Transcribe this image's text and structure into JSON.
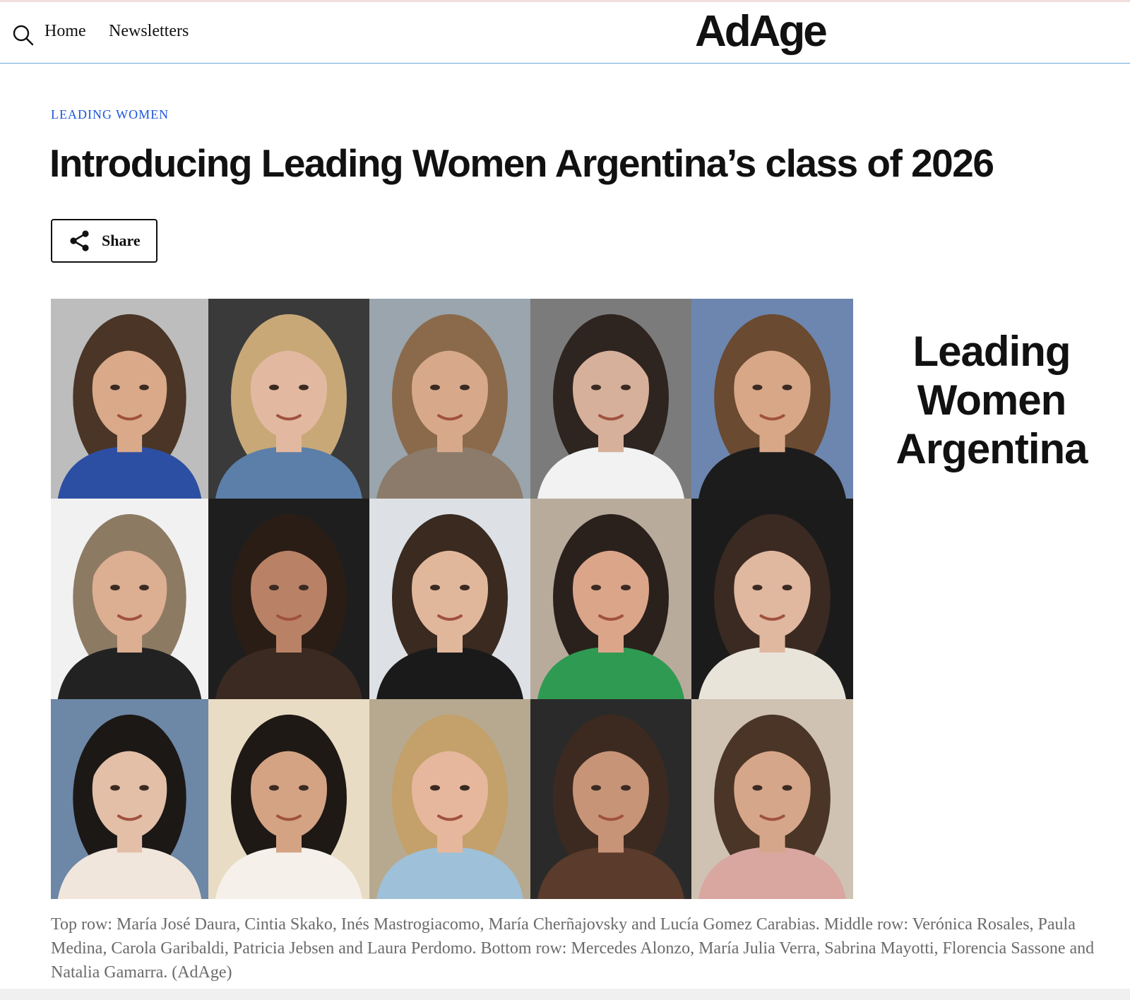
{
  "header": {
    "search_icon": "search-icon",
    "nav": [
      {
        "label": "Home"
      },
      {
        "label": "Newsletters"
      }
    ],
    "logo_text": "AdAge"
  },
  "article": {
    "kicker": "LEADING WOMEN",
    "headline": "Introducing Leading Women Argentina’s class of 2026",
    "share_label": "Share",
    "share_icon": "share-icon"
  },
  "hero": {
    "wordmark_lines": [
      "Leading",
      "Women",
      "Argentina"
    ],
    "portraits": [
      {
        "row": "top",
        "bg": "#bdbdbd",
        "hair": "#4a3526",
        "skin": "#d9a98a",
        "top": "#2d4fa3"
      },
      {
        "row": "top",
        "bg": "#3a3a3a",
        "hair": "#c9a878",
        "skin": "#e2b9a0",
        "top": "#5b7fa8"
      },
      {
        "row": "top",
        "bg": "#9aa5ad",
        "hair": "#8a6a4a",
        "skin": "#d7a98a",
        "top": "#8c7b6a"
      },
      {
        "row": "top",
        "bg": "#7b7b7b",
        "hair": "#2e2420",
        "skin": "#d6b09a",
        "top": "#f2f2f2"
      },
      {
        "row": "top",
        "bg": "#6d86b0",
        "hair": "#6a4a30",
        "skin": "#d8a788",
        "top": "#1c1c1c"
      },
      {
        "row": "middle",
        "bg": "#f1f1f1",
        "hair": "#8d7a63",
        "skin": "#dcae92",
        "top": "#222222"
      },
      {
        "row": "middle",
        "bg": "#1e1e1e",
        "hair": "#2a1d16",
        "skin": "#b98266",
        "top": "#3a2a22"
      },
      {
        "row": "middle",
        "bg": "#dde1e6",
        "hair": "#3a2a20",
        "skin": "#e1b79c",
        "top": "#1a1a1a"
      },
      {
        "row": "middle",
        "bg": "#b9ab9c",
        "hair": "#2a211c",
        "skin": "#dba58a",
        "top": "#2f9a52"
      },
      {
        "row": "middle",
        "bg": "#1b1b1b",
        "hair": "#3b2a22",
        "skin": "#e0b79f",
        "top": "#e9e4da"
      },
      {
        "row": "bottom",
        "bg": "#6d87a6",
        "hair": "#1c1816",
        "skin": "#e3bfa8",
        "top": "#f0e6dc"
      },
      {
        "row": "bottom",
        "bg": "#e8dcc4",
        "hair": "#1f1915",
        "skin": "#d4a384",
        "top": "#f5f1ea"
      },
      {
        "row": "bottom",
        "bg": "#b7a98f",
        "hair": "#c4a06a",
        "skin": "#e6b79c",
        "top": "#9ec0d8"
      },
      {
        "row": "bottom",
        "bg": "#2a2a2a",
        "hair": "#3c2a20",
        "skin": "#c79478",
        "top": "#5b3b2b"
      },
      {
        "row": "bottom",
        "bg": "#cfc2b2",
        "hair": "#4a3526",
        "skin": "#d6a68a",
        "top": "#d9a6a0"
      }
    ],
    "caption": "Top row: María José Daura, Cintia Skako, Inés Mastrogiacomo, María Cherñajovsky and Lucía Gomez Carabias. Middle row: Verónica Rosales, Paula Medina, Carola Garibaldi, Patricia Jebsen and Laura Perdomo. Bottom row: Mercedes Alonzo, María Julia Verra, Sabrina Mayotti, Florencia Sassone and Natalia Gamarra. (AdAge)"
  }
}
